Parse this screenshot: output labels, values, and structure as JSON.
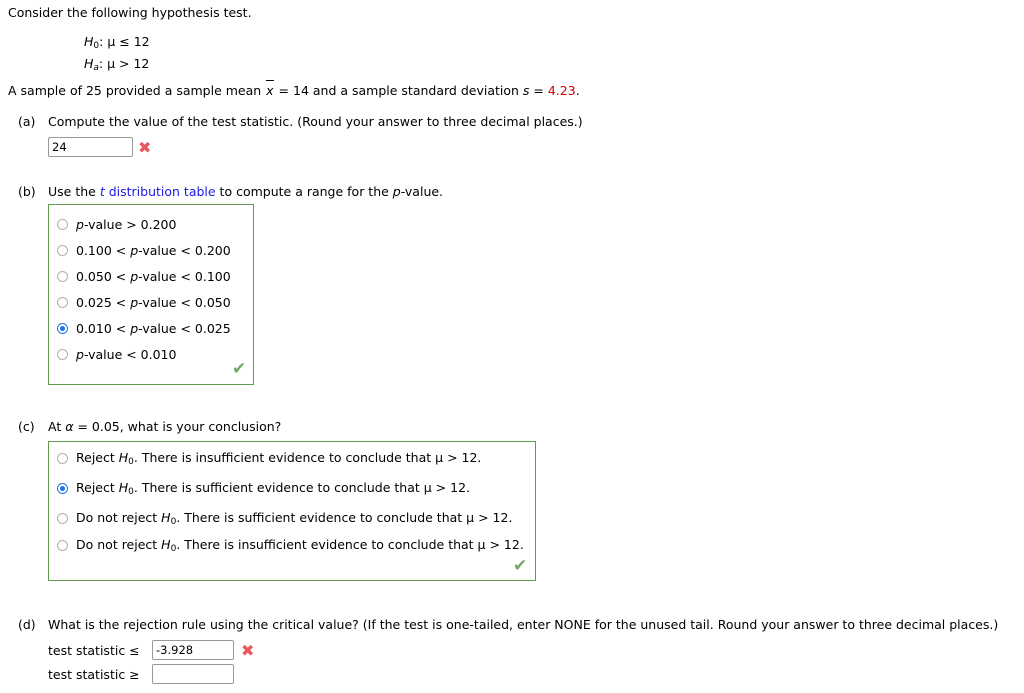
{
  "intro": {
    "line": "Consider the following hypothesis test."
  },
  "hypotheses": {
    "null_prefix": "H",
    "null_sub": "0",
    "null_rest": ": μ ≤ 12",
    "alt_prefix": "H",
    "alt_sub": "a",
    "alt_rest": ": μ > 12"
  },
  "sample": {
    "before_xbar": "A sample of 25 provided a sample mean ",
    "xbar": "x",
    "after_xbar": " = 14 and a sample standard deviation ",
    "s_italic": "s",
    "s_equals": " = ",
    "s_value": "4.23",
    "period": "."
  },
  "parts": {
    "a": {
      "label": "(a)",
      "question": "Compute the value of the test statistic. (Round your answer to three decimal places.)",
      "answer_value": "24",
      "grade_icon": "✖",
      "grade_state": "incorrect"
    },
    "b": {
      "label": "(b)",
      "prompt_before": "Use the ",
      "link_text_italic": "t",
      "link_text_rest": " distribution table",
      "prompt_after": " to compute a range for the ",
      "prompt_p": "p",
      "prompt_end": "-value.",
      "options": [
        {
          "pre": "",
          "p": "p",
          "post": "-value > 0.200",
          "selected": false
        },
        {
          "pre": "0.100 < ",
          "p": "p",
          "post": "-value < 0.200",
          "selected": false
        },
        {
          "pre": "0.050 < ",
          "p": "p",
          "post": "-value < 0.100",
          "selected": false
        },
        {
          "pre": "0.025 < ",
          "p": "p",
          "post": "-value < 0.050",
          "selected": false
        },
        {
          "pre": "0.010 < ",
          "p": "p",
          "post": "-value < 0.025",
          "selected": true
        },
        {
          "pre": "",
          "p": "p",
          "post": "-value < 0.010",
          "selected": false
        }
      ],
      "grade_icon": "✔",
      "grade_state": "correct"
    },
    "c": {
      "label": "(c)",
      "question_pre": "At ",
      "question_alpha": "α",
      "question_post": " = 0.05, what is your conclusion?",
      "options": [
        {
          "pre": "Reject ",
          "h": "H",
          "sub": "0",
          "post": ". There is insufficient evidence to conclude that μ > 12.",
          "selected": false
        },
        {
          "pre": "Reject ",
          "h": "H",
          "sub": "0",
          "post": ". There is sufficient evidence to conclude that μ > 12.",
          "selected": true
        },
        {
          "pre": "Do not reject ",
          "h": "H",
          "sub": "0",
          "post": ". There is sufficient evidence to conclude that μ > 12.",
          "selected": false
        },
        {
          "pre": "Do not reject ",
          "h": "H",
          "sub": "0",
          "post": ". There is insufficient evidence to conclude that μ > 12.",
          "selected": false
        }
      ],
      "grade_icon": "✔",
      "grade_state": "correct"
    },
    "d": {
      "label": "(d)",
      "question": "What is the rejection rule using the critical value? (If the test is one-tailed, enter NONE for the unused tail. Round your answer to three decimal places.)",
      "row1_label": "test statistic  ≤",
      "row1_value": "-3.928",
      "row1_grade_icon": "✖",
      "row1_grade_state": "incorrect",
      "row2_label": "test statistic  ≥",
      "row2_value": "",
      "row2_placeholder": ""
    }
  },
  "colors": {
    "link": "#1a1ae6",
    "red_value": "#cc0000",
    "incorrect_mark": "#e8585c",
    "correct_mark": "#72a866",
    "graded_border": "#5e9a4e",
    "radio_selected": "#1a73e8"
  }
}
